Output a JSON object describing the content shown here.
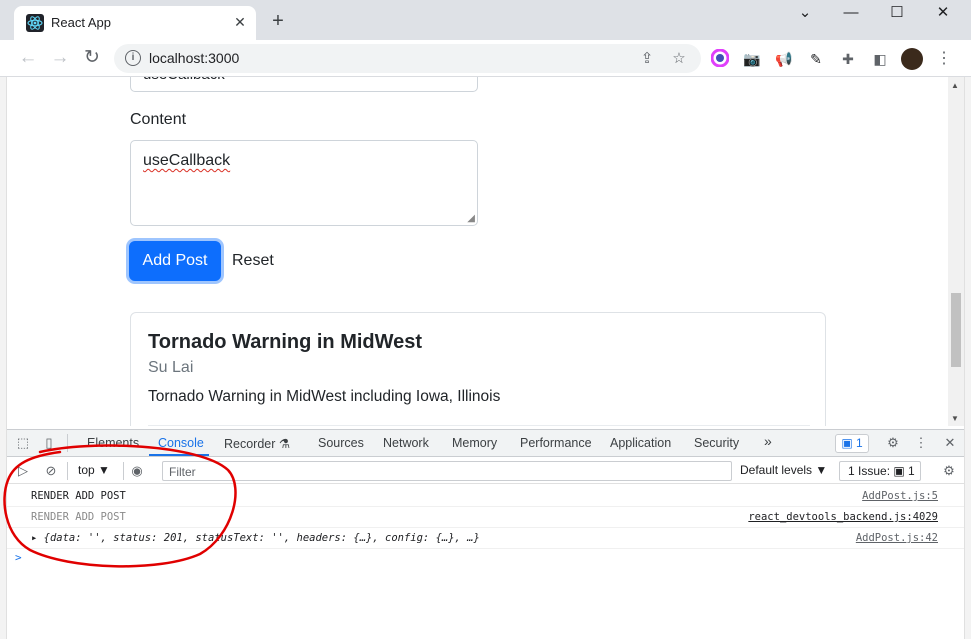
{
  "browser": {
    "tab_title": "React App",
    "tab_close": "✕",
    "new_tab": "+",
    "url": "localhost:3000",
    "window_controls": {
      "minimize": "—",
      "maximize": "☐",
      "close": "✕",
      "tab_search": "⌄"
    }
  },
  "page": {
    "title_value": "useCallback",
    "content_label": "Content",
    "content_value": "useCallback",
    "add_post_label": "Add Post",
    "reset_label": "Reset",
    "post": {
      "title": "Tornado Warning in MidWest",
      "author": "Su Lai",
      "body": "Tornado Warning in MidWest including Iowa, Illinois"
    }
  },
  "devtools": {
    "tabs": [
      "Elements",
      "Console",
      "Recorder ⚗",
      "Sources",
      "Network",
      "Memory",
      "Performance",
      "Application",
      "Security",
      "»"
    ],
    "issues_badge": "1",
    "context": "top ▼",
    "filter_placeholder": "Filter",
    "levels": "Default levels ▼",
    "issue_count": "1 Issue: ▣ 1",
    "logs": [
      {
        "message": "RENDER ADD POST",
        "source": "AddPost.js:5",
        "color": "#202124"
      },
      {
        "message": "RENDER ADD POST",
        "source": "react_devtools_backend.js:4029",
        "color": "#8a8a8a"
      },
      {
        "message": "▸ {data: '', status: 201, statusText: '', headers: {…}, config: {…}, …}",
        "source": "AddPost.js:42",
        "color": "#202124"
      }
    ],
    "prompt": ">"
  },
  "colors": {
    "primary_button": "#0d6efd",
    "annotation": "#e00000",
    "active_tab": "#1a73e8"
  }
}
